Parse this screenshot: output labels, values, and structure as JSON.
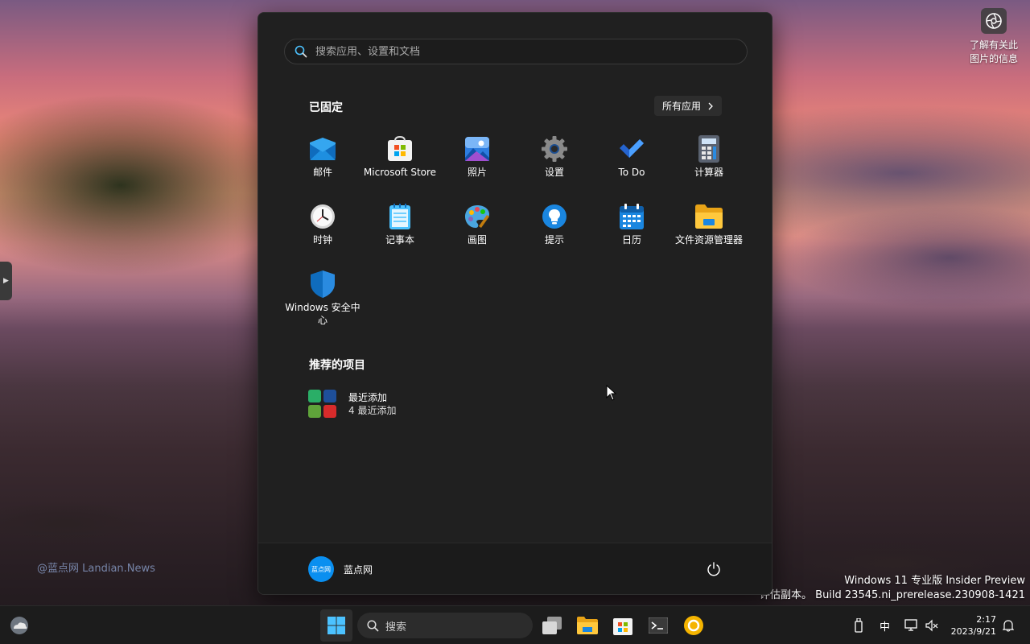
{
  "desktop": {
    "learn_more": "了解有关此图片的信息",
    "watermark_left": "@蓝点网 Landian.News",
    "watermark_line1": "Windows 11 专业版 Insider Preview",
    "watermark_line2": "评估副本。 Build 23545.ni_prerelease.230908-1421"
  },
  "start_menu": {
    "search_placeholder": "搜索应用、设置和文档",
    "pinned_title": "已固定",
    "all_apps_label": "所有应用",
    "pinned": [
      {
        "label": "邮件",
        "icon": "mail-icon"
      },
      {
        "label": "Microsoft Store",
        "icon": "store-icon"
      },
      {
        "label": "照片",
        "icon": "photos-icon"
      },
      {
        "label": "设置",
        "icon": "settings-icon"
      },
      {
        "label": "To Do",
        "icon": "todo-icon"
      },
      {
        "label": "计算器",
        "icon": "calculator-icon"
      },
      {
        "label": "时钟",
        "icon": "clock-icon"
      },
      {
        "label": "记事本",
        "icon": "notepad-icon"
      },
      {
        "label": "画图",
        "icon": "paint-icon"
      },
      {
        "label": "提示",
        "icon": "tips-icon"
      },
      {
        "label": "日历",
        "icon": "calendar-icon"
      },
      {
        "label": "文件资源管理器",
        "icon": "file-explorer-icon"
      },
      {
        "label": "Windows 安全中心",
        "icon": "security-icon"
      }
    ],
    "recommended_title": "推荐的项目",
    "recommended": {
      "title": "最近添加",
      "subtitle": "4 最近添加"
    },
    "user": {
      "name": "蓝点网",
      "avatar_text": "蓝点网"
    }
  },
  "taskbar": {
    "search_label": "搜索",
    "ime": "中",
    "time": "2:17",
    "date": "2023/9/21"
  },
  "colors": {
    "accent": "#0a8ff0",
    "menu_bg": "#202020",
    "taskbar_bg": "#1c1c1c"
  }
}
